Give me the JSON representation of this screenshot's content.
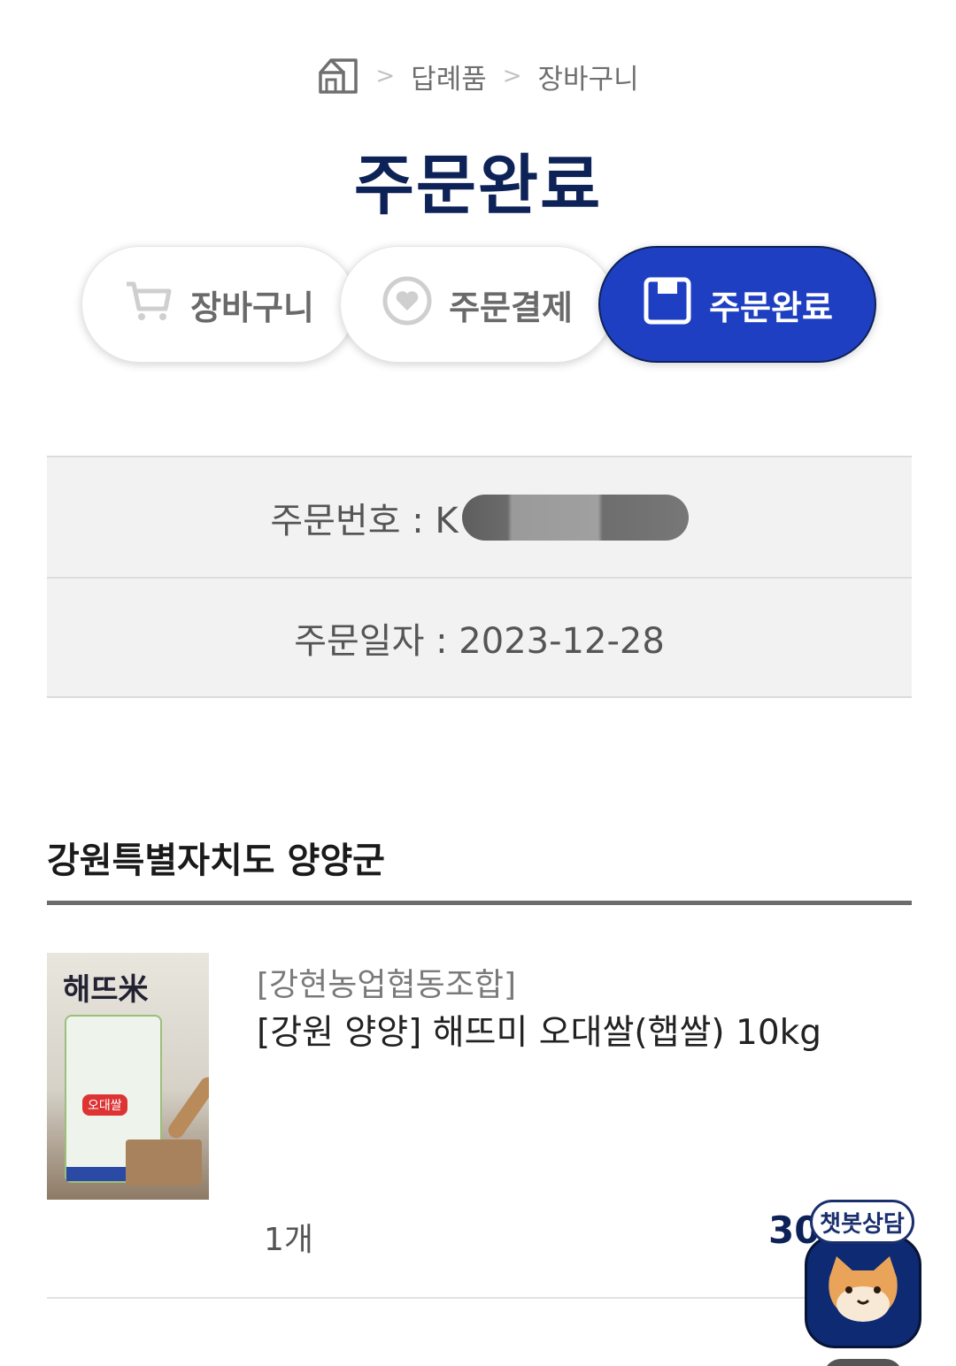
{
  "breadcrumb": {
    "home_icon": "home-icon",
    "items": [
      "답례품",
      "장바구니"
    ],
    "separator": ">"
  },
  "page_title": "주문완료",
  "steps": [
    {
      "label": "장바구니",
      "icon": "cart-icon",
      "active": false
    },
    {
      "label": "주문결제",
      "icon": "heart-icon",
      "active": false
    },
    {
      "label": "주문완료",
      "icon": "save-icon",
      "active": true
    }
  ],
  "order_info": {
    "number_label": "주문번호 : K",
    "date_label": "주문일자 : 2023-12-28"
  },
  "region": "강원특별자치도 양양군",
  "product": {
    "seller": "[강현농업협동조합]",
    "name": "[강원 양양] 해뜨미 오대쌀(햅쌀) 10kg",
    "quantity": "1개",
    "price_visible": "30,",
    "image_text": "해뜨米",
    "image_tag": "오대쌀"
  },
  "chatbot": {
    "label": "챗봇상담",
    "icon": "cat-face-icon"
  },
  "colors": {
    "navy": "#0d2256",
    "active_step": "#1f3fc2",
    "background_box": "#f2f2f2"
  }
}
